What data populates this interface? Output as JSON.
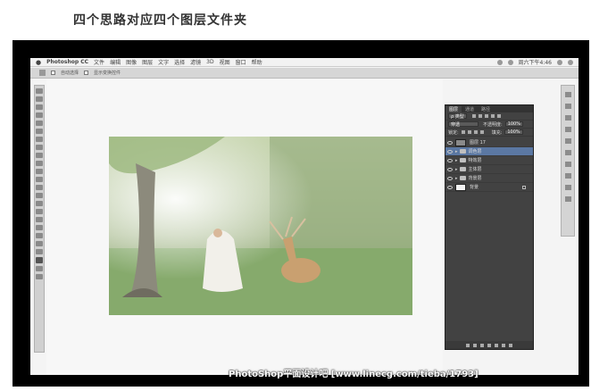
{
  "heading": "四个思路对应四个图层文件夹",
  "menubar": {
    "app_name": "Photoshop CC",
    "items": [
      "文件",
      "编辑",
      "图像",
      "图层",
      "文字",
      "选择",
      "滤镜",
      "3D",
      "视图",
      "窗口",
      "帮助"
    ],
    "clock": "周六下午4:46"
  },
  "optbar": {
    "auto_select": "自动选择",
    "show_transform": "显示变换控件"
  },
  "layers_panel": {
    "tabs": [
      "图层",
      "通道",
      "路径"
    ],
    "filter_kind": "ρ 类型",
    "blend_mode": "穿透",
    "opacity_label": "不透明度:",
    "opacity_value": "100%",
    "lock_label": "锁定:",
    "fill_label": "填充:",
    "fill_value": "100%",
    "layers": [
      {
        "name": "图层 17",
        "type": "layer",
        "selected": false
      },
      {
        "name": "调色层",
        "type": "group",
        "selected": true
      },
      {
        "name": "特效层",
        "type": "group",
        "selected": false
      },
      {
        "name": "主体层",
        "type": "group",
        "selected": false
      },
      {
        "name": "背景层",
        "type": "group",
        "selected": false
      },
      {
        "name": "背景",
        "type": "background",
        "selected": false
      }
    ]
  },
  "watermark": "PhotoShop平面设计吧 [www.linecg.com/tieba/1793]",
  "colors": {
    "panel_bg": "#424242",
    "selected_layer": "#5b78a3",
    "grass": "#7aa06a",
    "frame": "#000000"
  }
}
